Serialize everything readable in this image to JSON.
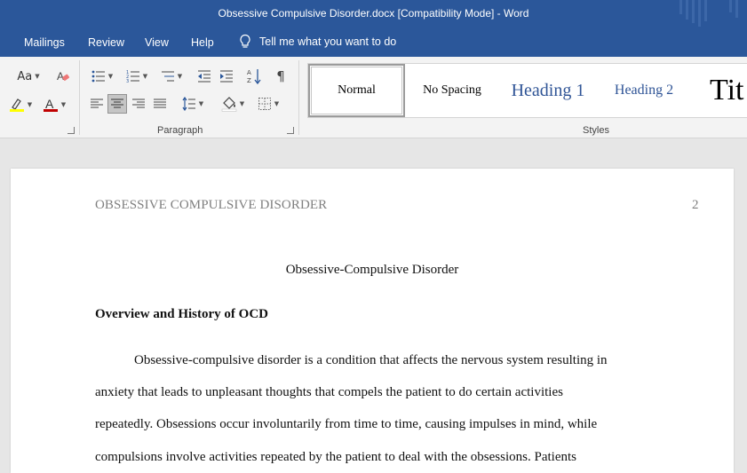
{
  "window": {
    "title": "Obsessive Compulsive Disorder.docx [Compatibility Mode]  -  Word"
  },
  "menu": {
    "tabs": [
      "Mailings",
      "Review",
      "View",
      "Help"
    ],
    "tell_me": "Tell me what you want to do"
  },
  "ribbon": {
    "font_group": {
      "change_case_label": "Aa"
    },
    "paragraph_group_label": "Paragraph",
    "styles_group_label": "Styles",
    "styles": {
      "normal": "Normal",
      "no_spacing": "No Spacing",
      "heading1": "Heading 1",
      "heading2": "Heading 2",
      "title": "Tit"
    },
    "colors": {
      "highlight": "#ffff00",
      "font_color": "#c00000",
      "heading_blue": "#2f5496"
    }
  },
  "document": {
    "running_header": "OBSESSIVE COMPULSIVE DISORDER",
    "page_number": "2",
    "title": "Obsessive-Compulsive Disorder",
    "heading": "Overview and History of OCD",
    "body_lines": [
      "Obsessive-compulsive disorder is a condition that affects the nervous system resulting in",
      "anxiety that leads to unpleasant thoughts that compels the patient to do certain activities",
      "repeatedly. Obsessions occur involuntarily from time to time, causing impulses in mind, while",
      "compulsions involve activities repeated by the patient to deal with the obsessions. Patients"
    ]
  }
}
